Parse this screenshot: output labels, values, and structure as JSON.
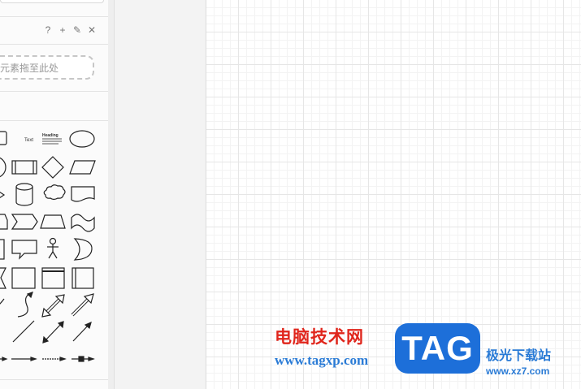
{
  "sidebar": {
    "scratchpad_tools": [
      {
        "icon": "help-icon",
        "glyph": "?"
      },
      {
        "icon": "add-icon",
        "glyph": "+"
      },
      {
        "icon": "edit-icon",
        "glyph": "✎"
      },
      {
        "icon": "close-icon",
        "glyph": "✕"
      }
    ],
    "drop_zone_text": "元素拖至此处",
    "shape_labels": {
      "text": "Text",
      "heading": "Heading"
    }
  },
  "watermark": {
    "title": "电脑技术网",
    "url": "www.tagxp.com",
    "badge": "TAG",
    "site_name": "极光下载站",
    "site_url": "www.xz7.com"
  }
}
